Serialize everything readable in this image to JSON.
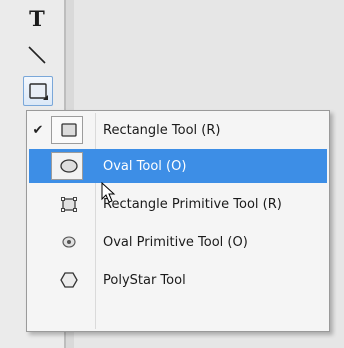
{
  "toolbar": {
    "text_tool_label": "T",
    "tools": [
      "text-icon",
      "line-icon",
      "rectangle-tool-group-icon"
    ]
  },
  "menu": {
    "items": [
      {
        "label": "Rectangle Tool (R)",
        "checked": true,
        "icon": "rectangle-icon",
        "active": false
      },
      {
        "label": "Oval Tool (O)",
        "checked": false,
        "icon": "oval-icon",
        "active": true
      },
      {
        "label": "Rectangle Primitive Tool (R)",
        "checked": false,
        "icon": "rectangle-primitive-icon",
        "active": false
      },
      {
        "label": "Oval Primitive Tool (O)",
        "checked": false,
        "icon": "oval-primitive-icon",
        "active": false
      },
      {
        "label": "PolyStar Tool",
        "checked": false,
        "icon": "polystar-icon",
        "active": false
      }
    ],
    "check_glyph": "✔"
  },
  "colors": {
    "highlight": "#3d8ee6",
    "menu_bg": "#f5f5f5"
  }
}
